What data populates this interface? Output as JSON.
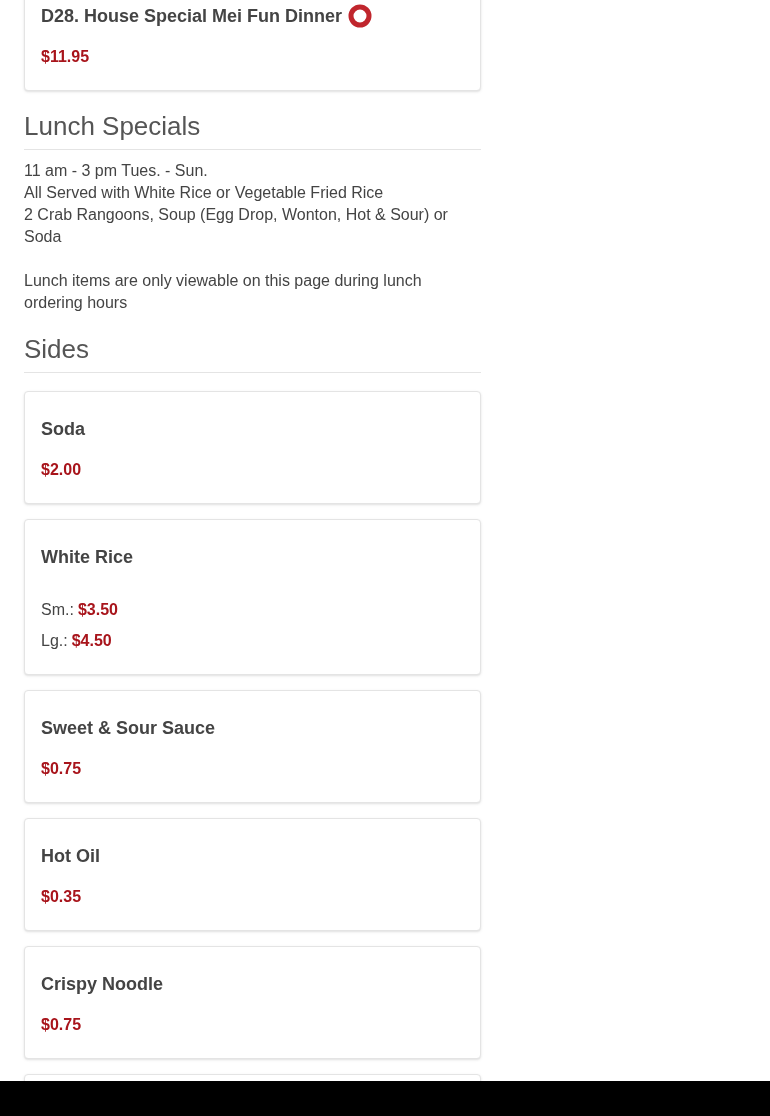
{
  "top_item": {
    "name": "D28. House Special Mei Fun Dinner",
    "hot": true,
    "prices": [
      {
        "value": "$11.95"
      }
    ]
  },
  "sections": [
    {
      "title": "Lunch Specials",
      "lines": [
        "11 am - 3 pm Tues. - Sun.",
        "All Served with White Rice or Vegetable Fried Rice",
        "2 Crab Rangoons, Soup (Egg Drop, Wonton, Hot & Sour) or Soda"
      ],
      "note": "Lunch items are only viewable on this page during lunch ordering hours"
    },
    {
      "title": "Sides",
      "items": [
        {
          "name": "Soda",
          "hot": false,
          "prices": [
            {
              "value": "$2.00"
            }
          ]
        },
        {
          "name": "White Rice",
          "hot": false,
          "prices": [
            {
              "label": "Sm.:",
              "value": "$3.50"
            },
            {
              "label": "Lg.:",
              "value": "$4.50"
            }
          ]
        },
        {
          "name": "Sweet & Sour Sauce",
          "hot": false,
          "prices": [
            {
              "value": "$0.75"
            }
          ]
        },
        {
          "name": "Hot Oil",
          "hot": false,
          "prices": [
            {
              "value": "$0.35"
            }
          ]
        },
        {
          "name": "Crispy Noodle",
          "hot": false,
          "prices": [
            {
              "value": "$0.75"
            }
          ]
        }
      ]
    }
  ]
}
